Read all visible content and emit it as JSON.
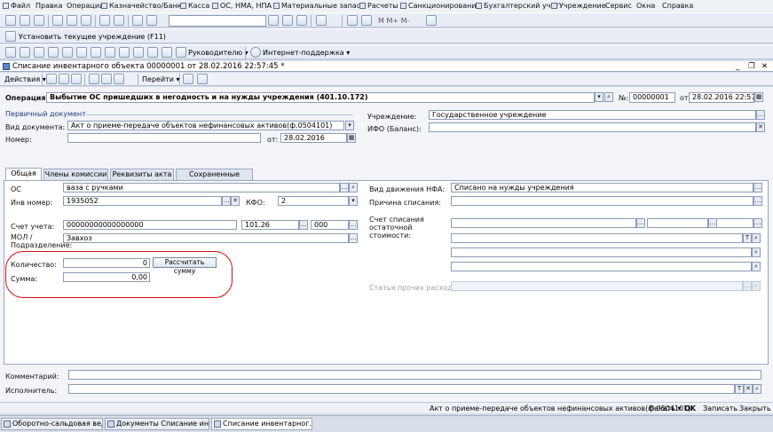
{
  "menu": [
    "Файл",
    "Правка",
    "Операции",
    "Казначейство/Банк",
    "Касса",
    "ОС, НМА, НПА",
    "Материальные запасы",
    "Расчеты",
    "Санкционирование",
    "Бухгалтерский учет",
    "Учреждение",
    "Сервис",
    "Окна",
    "Справка"
  ],
  "toolbar2": {
    "set_institution": "Установить текущее учреждение (F11)"
  },
  "toolbar3": {
    "manager": "Руководителю",
    "support": "Интернет-поддержка"
  },
  "document": {
    "title": "Списание инвентарного объекта 00000001 от 28.02.2016 22:57:45 *"
  },
  "commands": {
    "actions": "Действия",
    "goto": "Перейти"
  },
  "operation": {
    "label": "Операция:",
    "value": "Выбытие ОС пришедших в негодность и на нужды учреждения (401.10.172)",
    "number_label": "№:",
    "number": "00000001",
    "date_label": "от",
    "date": "28.02.2016 22:57:45"
  },
  "primary": {
    "section": "Первичный документ",
    "doc_type_label": "Вид документа:",
    "doc_type": "Акт о приеме-передаче объектов нефинансовых активов(ф.0504101)",
    "number_label": "Номер:",
    "number": "",
    "date_label": "от:",
    "date": "28.02.2016"
  },
  "institution": {
    "label": "Учреждение:",
    "value": "Государственное учреждение",
    "ifo_label": "ИФО (Баланс):",
    "ifo": ""
  },
  "tabs": [
    "Общая",
    "Члены комиссии",
    "Реквизиты акта",
    "Сохраненные формы"
  ],
  "general": {
    "os_label": "ОС",
    "os": "ваза с ручками",
    "inv_label": "Инв номер:",
    "inv": "1935052",
    "kfo_label": "КФО:",
    "kfo": "2",
    "account_label": "Счет учета:",
    "account_code": "00000000000000000",
    "account_sub": "101.26",
    "account_ext": "000",
    "mol_label": "МОЛ / Подразделение:",
    "mol": "Завхоз",
    "qty_label": "Количество:",
    "qty": "0",
    "calc_button": "Рассчитать сумму",
    "sum_label": "Сумма:",
    "sum": "0,00",
    "move_label": "Вид движения НФА:",
    "move": "Списано на нужды учреждения",
    "reason_label": "Причина списания:",
    "reason": "",
    "writeoff_label": "Счет списания остаточной стоимости:",
    "other_exp_label": "Статья прочих расходов:"
  },
  "comment_label": "Комментарий:",
  "comment": "",
  "executor_label": "Исполнитель:",
  "executor": "",
  "status": {
    "act": "Акт о приеме-передаче объектов нефинансовых активов(ф.0504101)",
    "print": "Печать",
    "ok": "OK",
    "save": "Записать",
    "close": "Закрыть"
  },
  "taskbar": [
    "Оборотно-сальдовая ведом...",
    "Документы Списание инве...",
    "Списание инвентарног...45 *"
  ],
  "colors": {
    "accent_red": "#d41010",
    "section_blue": "#1f3b83"
  }
}
